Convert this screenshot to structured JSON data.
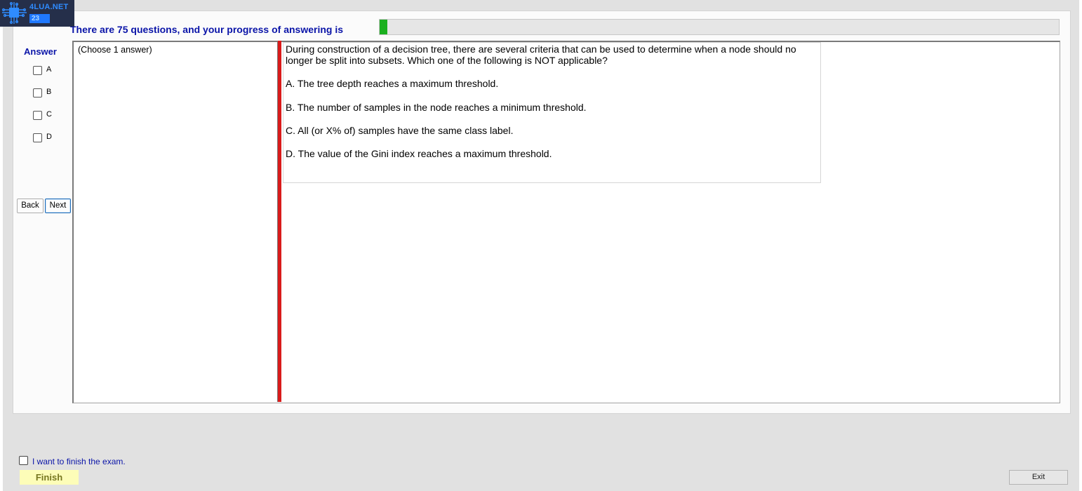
{
  "logo": {
    "site": "4LUA.NET",
    "badge": "23",
    "icon": "circuit-chip-icon"
  },
  "progress": {
    "caption": "There are 75 questions, and your progress of answering is",
    "fraction": 0.011,
    "color": "#1bb01f"
  },
  "answer_panel": {
    "heading": "Answer",
    "options": [
      "A",
      "B",
      "C",
      "D"
    ]
  },
  "nav": {
    "back": "Back",
    "next": "Next"
  },
  "question": {
    "instruction": "(Choose 1 answer)",
    "text": "During construction of a decision tree, there are several criteria that can be used to determine when a node should no longer be split into subsets. Which one of the following is NOT applicable?",
    "options": [
      "A.  The tree depth reaches a maximum threshold.",
      "B.  The number of samples in the node reaches a minimum threshold.",
      "C.  All (or X% of) samples have the same class label.",
      "D.  The value of the Gini index reaches a maximum threshold."
    ]
  },
  "footer": {
    "finish_checkbox_label": "I want to finish the exam.",
    "finish_button": "Finish",
    "exit_button": "Exit"
  },
  "colors": {
    "accent_text": "#0a14a8",
    "splitter": "#d91b1b",
    "finish_bg": "#fdfdb8"
  }
}
